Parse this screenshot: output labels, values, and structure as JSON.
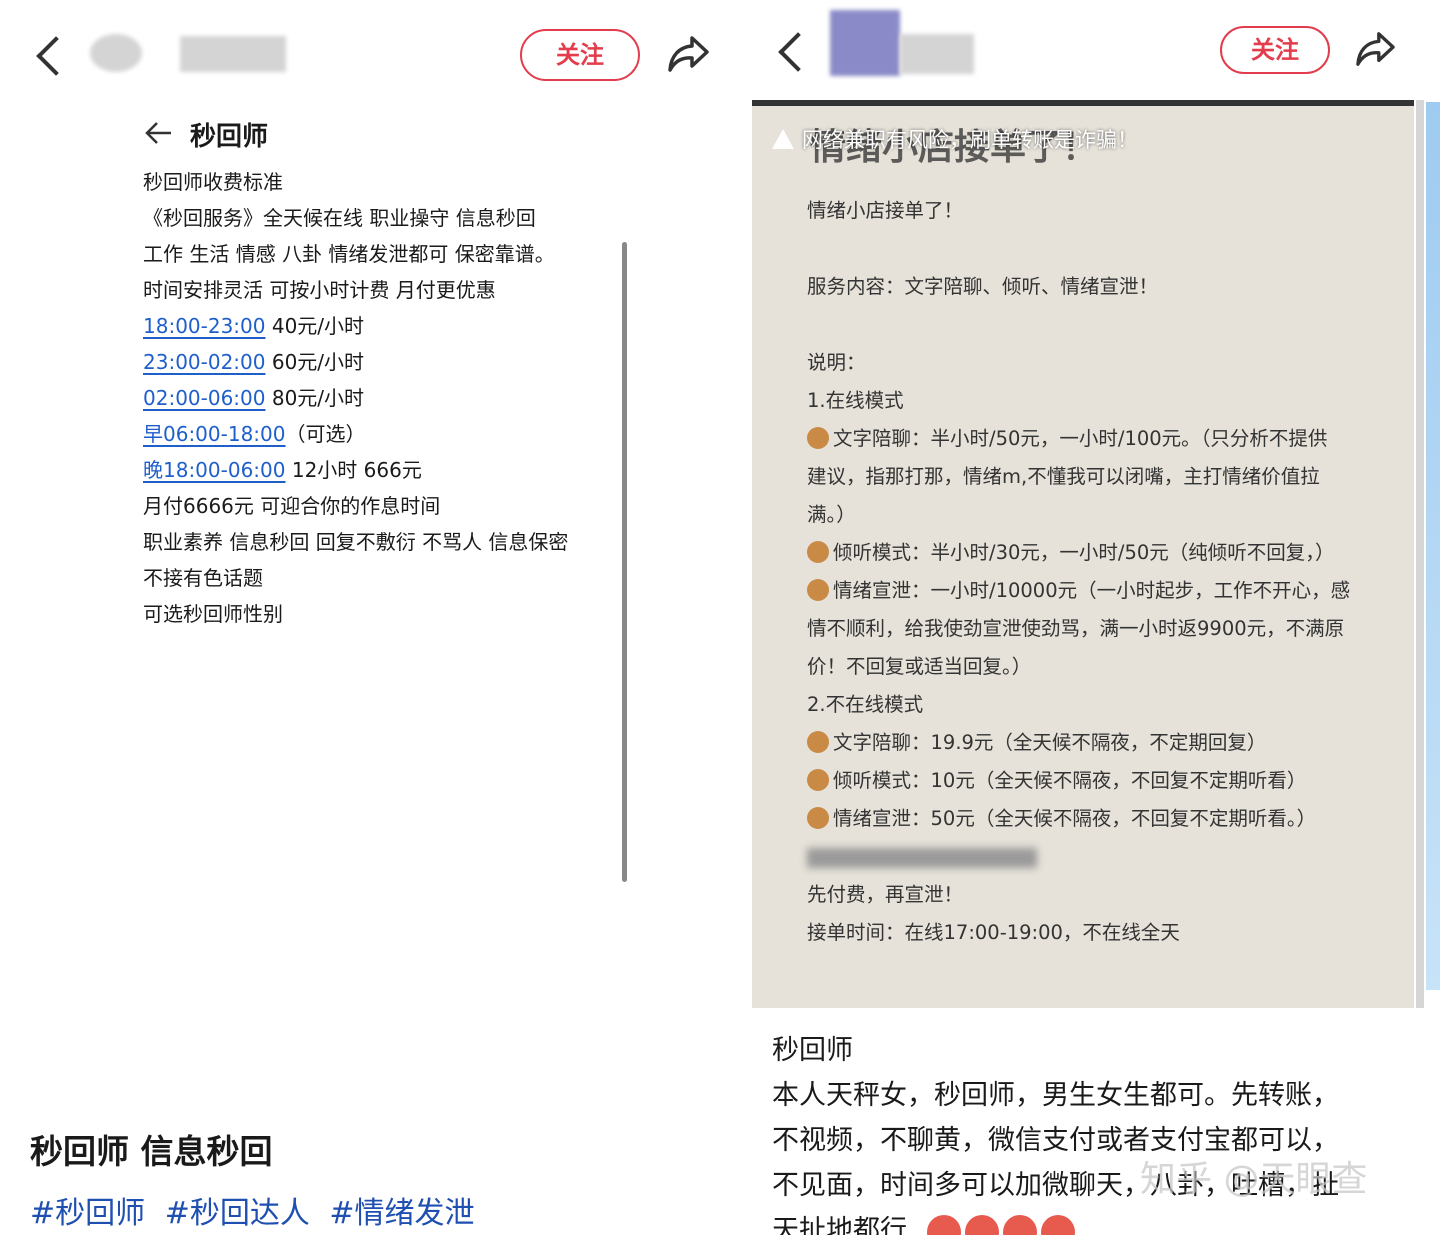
{
  "left": {
    "follow_label": "关注",
    "nav_title": "秒回师",
    "post_lines": [
      "秒回师收费标准",
      "《秒回服务》全天候在线 职业操守 信息秒回",
      "工作 生活 情感 八卦 情绪发泄都可 保密靠谱。",
      "时间安排灵活 可按小时计费 月付更优惠"
    ],
    "price_lines": [
      {
        "time": "18:00-23:00",
        "price": " 40元/小时"
      },
      {
        "time": "23:00-02:00",
        "price": " 60元/小时"
      },
      {
        "time": "02:00-06:00",
        "price": " 80元/小时"
      },
      {
        "time": "早06:00-18:00",
        "price": "（可选）"
      },
      {
        "time": "晚18:00-06:00",
        "price": " 12小时 666元"
      }
    ],
    "post_lines_after": [
      "月付6666元 可迎合你的作息时间",
      "职业素养 信息秒回 回复不敷衍 不骂人 信息保密",
      "不接有色话题",
      "可选秒回师性别"
    ],
    "title": "秒回师 信息秒回",
    "tags": [
      "#秒回师",
      "#秒回达人",
      "#情绪发泄"
    ]
  },
  "right": {
    "follow_label": "关注",
    "image_title": "情绪小店接单了！",
    "warning": "网络兼职有风险，刷单转账是诈骗！",
    "image_lines": [
      {
        "emoji": false,
        "text": "情绪小店接单了！"
      },
      {
        "emoji": false,
        "text": ""
      },
      {
        "emoji": false,
        "text": "服务内容：文字陪聊、倾听、情绪宣泄！"
      },
      {
        "emoji": false,
        "text": ""
      },
      {
        "emoji": false,
        "text": "说明："
      },
      {
        "emoji": false,
        "text": "1.在线模式"
      },
      {
        "emoji": true,
        "text": "文字陪聊：半小时/50元，一小时/100元。（只分析不提供"
      },
      {
        "emoji": false,
        "text": "建议，指那打那，情绪m,不懂我可以闭嘴，主打情绪价值拉"
      },
      {
        "emoji": false,
        "text": "满。）"
      },
      {
        "emoji": true,
        "text": "倾听模式：半小时/30元，一小时/50元（纯倾听不回复，）"
      },
      {
        "emoji": true,
        "text": "情绪宣泄：一小时/10000元（一小时起步，工作不开心，感"
      },
      {
        "emoji": false,
        "text": "情不顺利，给我使劲宣泄使劲骂，满一小时返9900元，不满原"
      },
      {
        "emoji": false,
        "text": "价！不回复或适当回复。）"
      },
      {
        "emoji": false,
        "text": "2.不在线模式"
      },
      {
        "emoji": true,
        "text": "文字陪聊：19.9元（全天候不隔夜，不定期回复）"
      },
      {
        "emoji": true,
        "text": "倾听模式：10元（全天候不隔夜，不回复不定期听看）"
      },
      {
        "emoji": true,
        "text": "情绪宣泄：50元（全天候不隔夜，不回复不定期听看。）"
      },
      {
        "emoji": false,
        "text": "",
        "blurred": true
      },
      {
        "emoji": false,
        "text": "先付费，再宣泄！"
      },
      {
        "emoji": false,
        "text": "接单时间：在线17:00-19:00，不在线全天"
      }
    ],
    "caption_lines": [
      "秒回师",
      "本人天秤女，秒回师，男生女生都可。先转账，",
      "不视频，不聊黄，微信支付或者支付宝都可以，",
      "不见面，时间多可以加微聊天，八卦，吐槽，扯",
      "天扯地都行"
    ],
    "watermark": "知乎 @天眼查"
  }
}
